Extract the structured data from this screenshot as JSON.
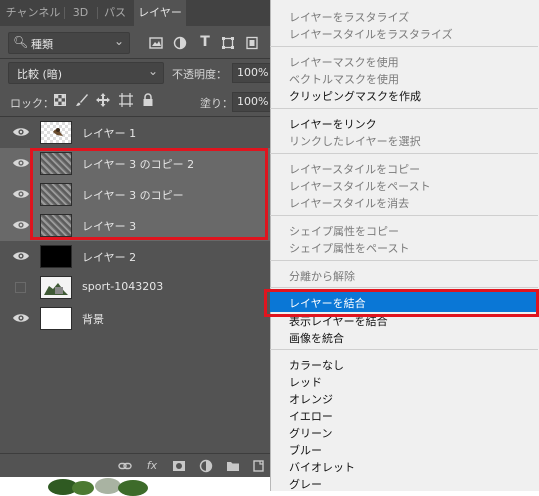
{
  "tabs": [
    "チャンネル",
    "3D",
    "パス",
    "レイヤー"
  ],
  "active_tab": "レイヤー",
  "filter": {
    "value": "種類",
    "icons": [
      "image-filter-icon",
      "adjustment-filter-icon",
      "type-filter-icon",
      "shape-filter-icon",
      "smart-object-filter-icon"
    ]
  },
  "blend_mode": "比較 (暗)",
  "opacity": {
    "label": "不透明度：",
    "value": "100%"
  },
  "lock": {
    "label": "ロック：",
    "icons": [
      "lock-transparent-icon",
      "lock-image-icon",
      "lock-position-icon",
      "lock-artboard-icon",
      "lock-all-icon"
    ]
  },
  "fill": {
    "label": "塗り：",
    "value": "100%"
  },
  "layers": [
    {
      "name": "レイヤー 1",
      "visible": true,
      "selected": false,
      "thumb": "transparent-sketch"
    },
    {
      "name": "レイヤー 3 のコピー 2",
      "visible": true,
      "selected": true,
      "thumb": "noise"
    },
    {
      "name": "レイヤー 3 のコピー",
      "visible": true,
      "selected": true,
      "thumb": "noise"
    },
    {
      "name": "レイヤー 3",
      "visible": true,
      "selected": true,
      "thumb": "noise"
    },
    {
      "name": "レイヤー 2",
      "visible": true,
      "selected": false,
      "thumb": "black"
    },
    {
      "name": "sport-1043203",
      "visible": false,
      "selected": false,
      "thumb": "photo"
    },
    {
      "name": "背景",
      "visible": true,
      "selected": false,
      "thumb": "white"
    }
  ],
  "footer_icons": [
    "link-icon",
    "fx-icon",
    "mask-icon",
    "adjustment-icon",
    "folder-icon",
    "new-layer-icon"
  ],
  "menu": {
    "groups": [
      [
        {
          "label": "レイヤーをラスタライズ",
          "enabled": false
        },
        {
          "label": "レイヤースタイルをラスタライズ",
          "enabled": false
        }
      ],
      [
        {
          "label": "レイヤーマスクを使用",
          "enabled": false
        },
        {
          "label": "ベクトルマスクを使用",
          "enabled": false
        },
        {
          "label": "クリッピングマスクを作成",
          "enabled": true
        }
      ],
      [
        {
          "label": "レイヤーをリンク",
          "enabled": true
        },
        {
          "label": "リンクしたレイヤーを選択",
          "enabled": false
        }
      ],
      [
        {
          "label": "レイヤースタイルをコピー",
          "enabled": false
        },
        {
          "label": "レイヤースタイルをペースト",
          "enabled": false
        },
        {
          "label": "レイヤースタイルを消去",
          "enabled": false
        }
      ],
      [
        {
          "label": "シェイプ属性をコピー",
          "enabled": false
        },
        {
          "label": "シェイプ属性をペースト",
          "enabled": false
        }
      ],
      [
        {
          "label": "分離から解除",
          "enabled": false
        }
      ],
      [
        {
          "label": "レイヤーを結合",
          "enabled": true,
          "highlighted": true
        },
        {
          "label": "表示レイヤーを結合",
          "enabled": true
        },
        {
          "label": "画像を統合",
          "enabled": true
        }
      ],
      [
        {
          "label": "カラーなし",
          "enabled": true
        },
        {
          "label": "レッド",
          "enabled": true
        },
        {
          "label": "オレンジ",
          "enabled": true
        },
        {
          "label": "イエロー",
          "enabled": true
        },
        {
          "label": "グリーン",
          "enabled": true
        },
        {
          "label": "ブルー",
          "enabled": true
        },
        {
          "label": "バイオレット",
          "enabled": true
        },
        {
          "label": "グレー",
          "enabled": true
        }
      ]
    ]
  },
  "colors": {
    "panel": "#535353",
    "selected_layer": "#696969",
    "menu_bg": "#f0f0f0",
    "menu_highlight": "#0a77d6",
    "annotation_red": "#e0141e"
  }
}
